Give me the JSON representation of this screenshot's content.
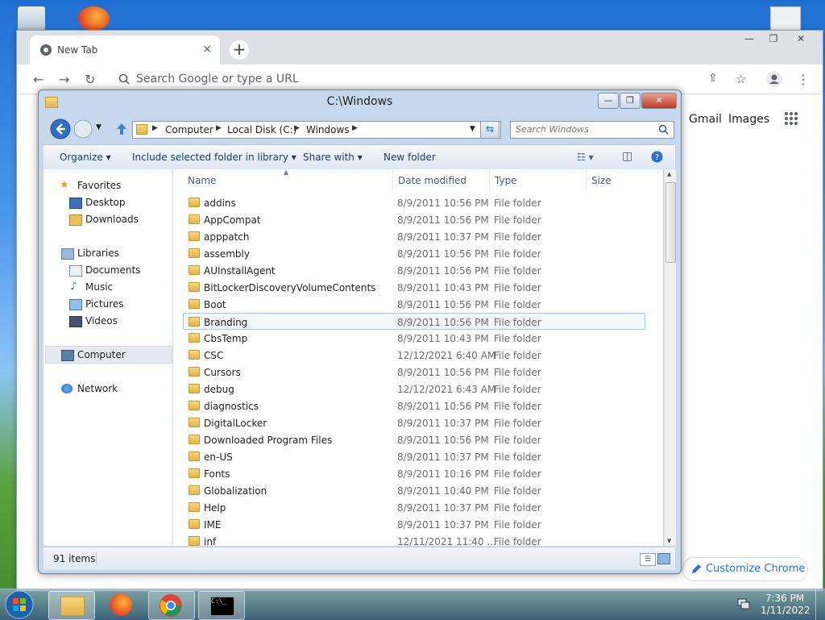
{
  "chrome": {
    "tab_title": "New Tab",
    "tab_close": "×",
    "new_tab": "+",
    "omnibox_placeholder": "Search Google or type a URL",
    "gmail": "Gmail",
    "images": "Images",
    "customize": "Customize Chrome",
    "window_min": "—",
    "window_max": "❐",
    "window_close": "✕"
  },
  "explorer": {
    "title": "C:\\Windows",
    "breadcrumbs": [
      "Computer",
      "Local Disk (C:)",
      "Windows"
    ],
    "search_placeholder": "Search Windows",
    "toolbar": {
      "organize": "Organize ▾",
      "include": "Include selected folder in library ▾",
      "share": "Share with ▾",
      "new_folder": "New folder"
    },
    "nav": {
      "favorites": "Favorites",
      "desktop": "Desktop",
      "downloads": "Downloads",
      "libraries": "Libraries",
      "documents": "Documents",
      "music": "Music",
      "pictures": "Pictures",
      "videos": "Videos",
      "computer": "Computer",
      "network": "Network"
    },
    "columns": {
      "name": "Name",
      "date": "Date modified",
      "type": "Type",
      "size": "Size"
    },
    "files": [
      {
        "name": "addins",
        "date": "8/9/2011 10:56 PM",
        "type": "File folder"
      },
      {
        "name": "AppCompat",
        "date": "8/9/2011 10:56 PM",
        "type": "File folder"
      },
      {
        "name": "apppatch",
        "date": "8/9/2011 10:37 PM",
        "type": "File folder"
      },
      {
        "name": "assembly",
        "date": "8/9/2011 10:56 PM",
        "type": "File folder"
      },
      {
        "name": "AUInstallAgent",
        "date": "8/9/2011 10:56 PM",
        "type": "File folder"
      },
      {
        "name": "BitLockerDiscoveryVolumeContents",
        "date": "8/9/2011 10:43 PM",
        "type": "File folder"
      },
      {
        "name": "Boot",
        "date": "8/9/2011 10:56 PM",
        "type": "File folder"
      },
      {
        "name": "Branding",
        "date": "8/9/2011 10:56 PM",
        "type": "File folder"
      },
      {
        "name": "CbsTemp",
        "date": "8/9/2011 10:43 PM",
        "type": "File folder"
      },
      {
        "name": "CSC",
        "date": "12/12/2021 6:40 AM",
        "type": "File folder"
      },
      {
        "name": "Cursors",
        "date": "8/9/2011 10:56 PM",
        "type": "File folder"
      },
      {
        "name": "debug",
        "date": "12/12/2021 6:43 AM",
        "type": "File folder"
      },
      {
        "name": "diagnostics",
        "date": "8/9/2011 10:56 PM",
        "type": "File folder"
      },
      {
        "name": "DigitalLocker",
        "date": "8/9/2011 10:37 PM",
        "type": "File folder"
      },
      {
        "name": "Downloaded Program Files",
        "date": "8/9/2011 10:56 PM",
        "type": "File folder"
      },
      {
        "name": "en-US",
        "date": "8/9/2011 10:37 PM",
        "type": "File folder"
      },
      {
        "name": "Fonts",
        "date": "8/9/2011 10:16 PM",
        "type": "File folder"
      },
      {
        "name": "Globalization",
        "date": "8/9/2011 10:40 PM",
        "type": "File folder"
      },
      {
        "name": "Help",
        "date": "8/9/2011 10:37 PM",
        "type": "File folder"
      },
      {
        "name": "IME",
        "date": "8/9/2011 10:37 PM",
        "type": "File folder"
      },
      {
        "name": "inf",
        "date": "12/11/2021 11:40 ...",
        "type": "File folder"
      }
    ],
    "selected_index": 7,
    "status": "91 items"
  },
  "taskbar": {
    "time": "7:36 PM",
    "date": "1/11/2022"
  }
}
